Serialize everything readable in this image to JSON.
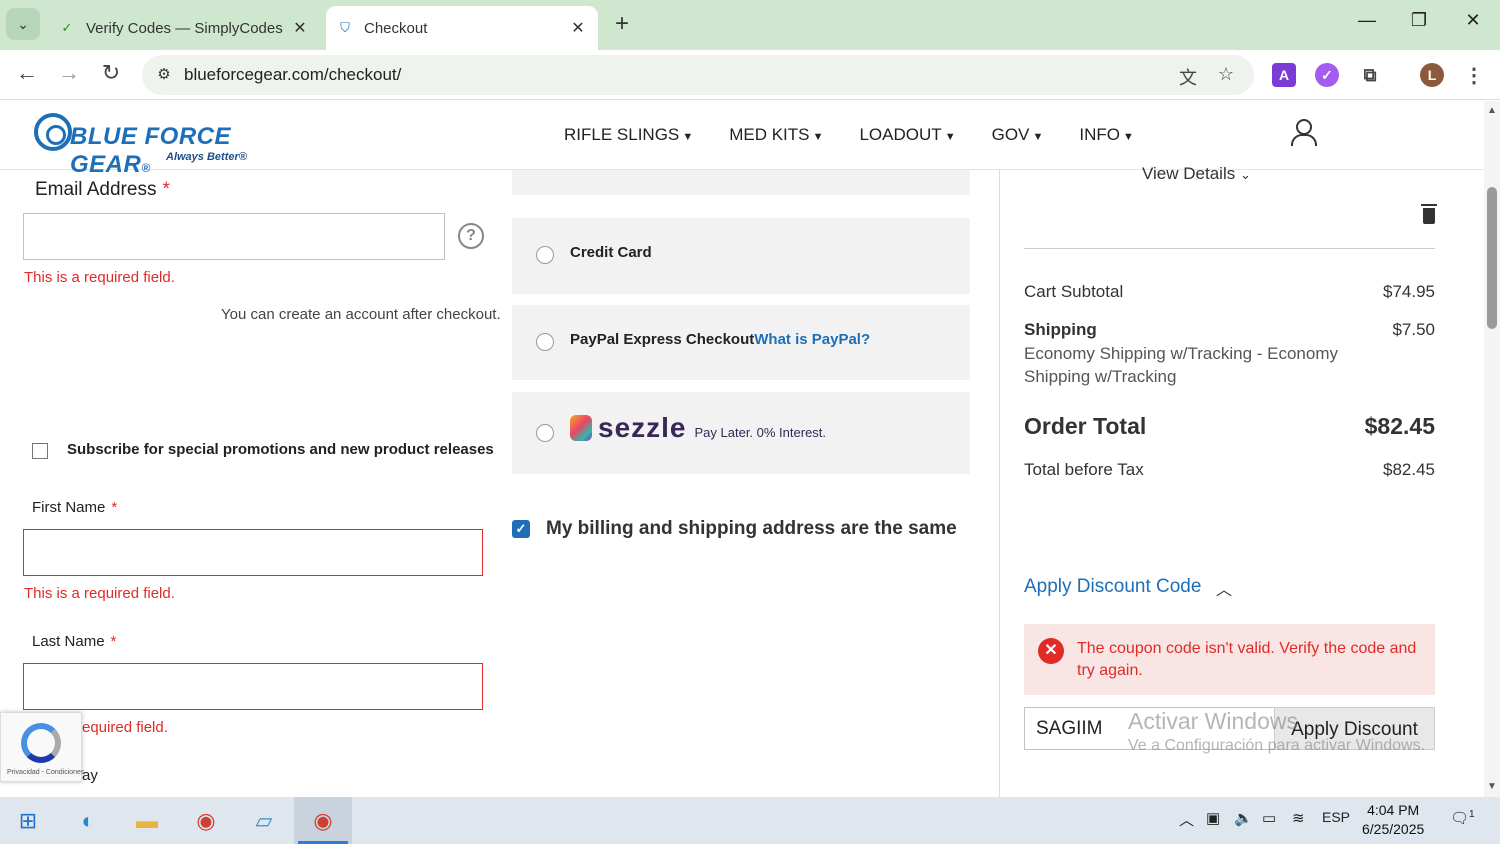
{
  "browser": {
    "tabs": [
      {
        "title": "Verify Codes — SimplyCodes",
        "active": false
      },
      {
        "title": "Checkout",
        "active": true
      }
    ],
    "url": "blueforcegear.com/checkout/",
    "profile_initial": "L",
    "ext_a_label": "A"
  },
  "site": {
    "logo_text": "BLUE FORCE GEAR",
    "logo_registered": "®",
    "tagline": "Always Better",
    "tagline_registered": "®",
    "nav": [
      "RIFLE SLINGS",
      "MED KITS",
      "LOADOUT",
      "GOV",
      "INFO"
    ],
    "brand_color": "#1e6fb8"
  },
  "form": {
    "email_label": "Email Address",
    "required_mark": "*",
    "email_error": "This is a required field.",
    "help_glyph": "?",
    "account_note": "You can create an account after checkout.",
    "subscribe_label": "Subscribe for special promotions and new product releases",
    "first_name_label": "First Name",
    "first_name_error": "This is a required field.",
    "last_name_label": "Last Name",
    "last_name_error": "equired field.",
    "partial_label": "ay"
  },
  "payment": {
    "credit_card": "Credit Card",
    "paypal": "PayPal Express Checkout",
    "paypal_link": "What is PayPal?",
    "sezzle_word": "sezzle",
    "sezzle_tagline": "Pay Later. 0% Interest.",
    "billing_same": "My billing and shipping address are the same",
    "billing_checked": true
  },
  "summary": {
    "view_details": "View Details",
    "cart_subtotal_label": "Cart Subtotal",
    "cart_subtotal": "$74.95",
    "shipping_label": "Shipping",
    "shipping_method": "Economy Shipping w/Tracking - Economy Shipping w/Tracking",
    "shipping_value": "$7.50",
    "order_total_label": "Order Total",
    "order_total": "$82.45",
    "before_tax_label": "Total before Tax",
    "before_tax": "$82.45",
    "discount_title": "Apply Discount Code",
    "discount_error": "The coupon code isn't valid. Verify the code and try again.",
    "coupon_value": "SAGIIM",
    "apply_button": "Apply Discount",
    "error_color": "#e02b27"
  },
  "overlay": {
    "watermark_title": "Activar Windows",
    "watermark_sub": "Ve a Configuración para activar Windows.",
    "recaptcha_text": "Privacidad - Condiciones"
  },
  "taskbar": {
    "language": "ESP",
    "time": "4:04 PM",
    "date": "6/25/2025",
    "notifications": "1"
  }
}
